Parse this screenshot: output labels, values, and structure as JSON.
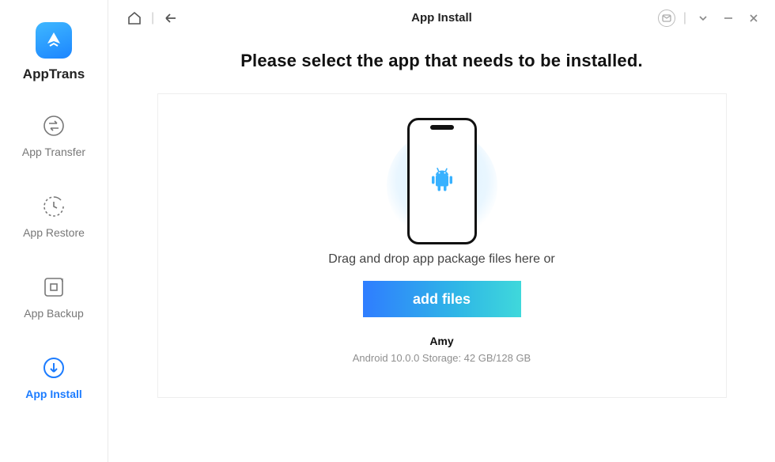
{
  "brand": {
    "name": "AppTrans"
  },
  "sidebar": {
    "items": [
      {
        "label": "App Transfer"
      },
      {
        "label": "App Restore"
      },
      {
        "label": "App Backup"
      },
      {
        "label": "App Install"
      }
    ],
    "activeIndex": 3
  },
  "header": {
    "title": "App Install"
  },
  "main": {
    "headline": "Please select the app that needs to be installed.",
    "drop_hint": "Drag and drop app package files here or",
    "add_files_label": "add files",
    "device": {
      "name": "Amy",
      "info": "Android 10.0.0 Storage: 42 GB/128 GB"
    }
  }
}
